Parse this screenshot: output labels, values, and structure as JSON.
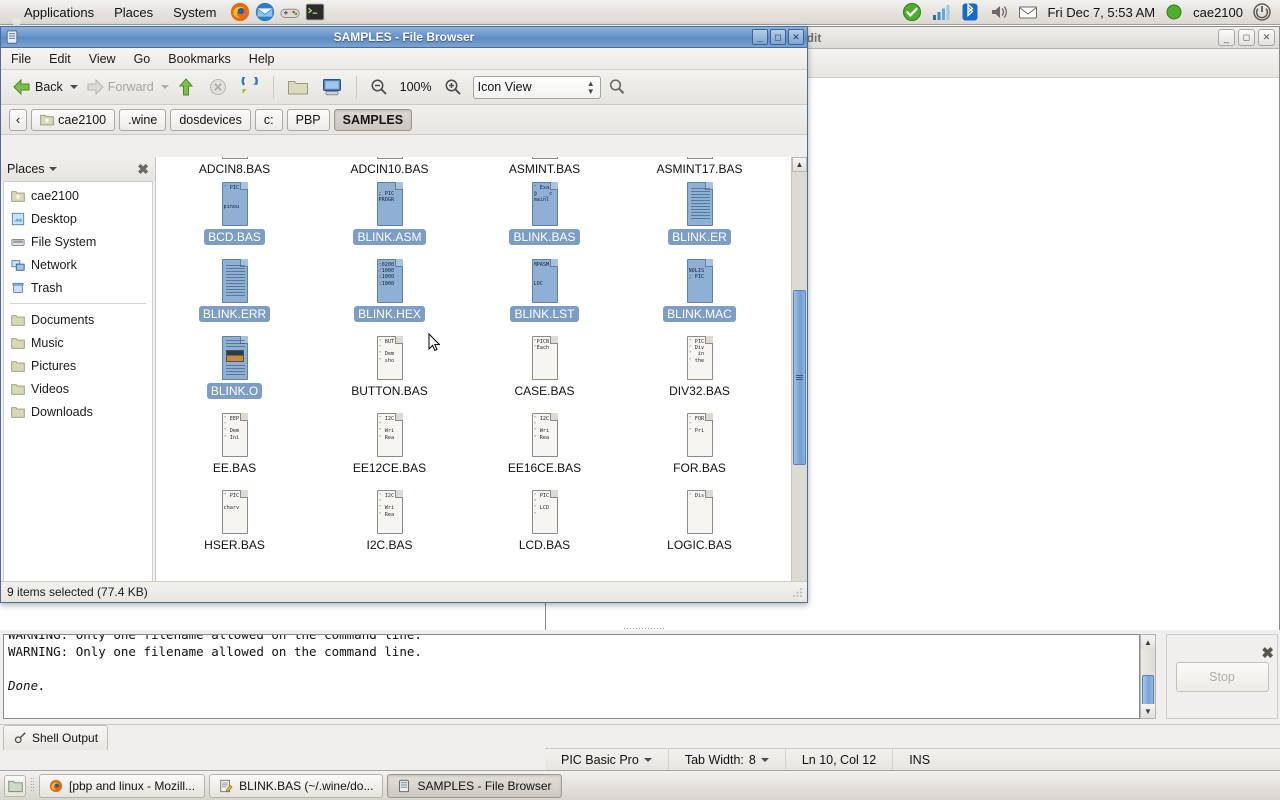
{
  "top_panel": {
    "menus": [
      "Applications",
      "Places",
      "System"
    ],
    "launchers": [
      "firefox-icon",
      "thunderbird-icon",
      "gamepad-icon",
      "terminal-icon"
    ],
    "tray": [
      "update-manager-icon",
      "network-signal-icon",
      "bluetooth-icon",
      "volume-icon",
      "mail-icon"
    ],
    "clock": "Fri Dec  7,  5:53 AM",
    "user": "cae2100",
    "power": "power-icon"
  },
  "gedit_window": {
    "title": "edit",
    "buttons": [
      "minimize",
      "maximize",
      "close"
    ]
  },
  "file_browser": {
    "title": "SAMPLES - File Browser",
    "window_buttons": [
      "minimize",
      "maximize",
      "close"
    ],
    "menus": [
      "File",
      "Edit",
      "View",
      "Go",
      "Bookmarks",
      "Help"
    ],
    "toolbar": {
      "back": "Back",
      "forward": "Forward",
      "up": "up-icon",
      "stop": "stop-icon",
      "reload": "reload-icon",
      "home": "home-icon",
      "computer": "computer-icon",
      "zoom_out": "zoom-out-icon",
      "zoom_level": "100%",
      "zoom_in": "zoom-in-icon",
      "view_mode": "Icon View",
      "search": "search-icon"
    },
    "pathbar": {
      "prev": "‹",
      "crumbs": [
        {
          "label": "cae2100",
          "icon": "home-folder-icon",
          "active": false
        },
        {
          "label": ".wine",
          "active": false
        },
        {
          "label": "dosdevices",
          "active": false
        },
        {
          "label": "c:",
          "active": false
        },
        {
          "label": "PBP",
          "active": false
        },
        {
          "label": "SAMPLES",
          "active": true
        }
      ]
    },
    "sidebar": {
      "header": "Places",
      "close": "close-icon",
      "group1": [
        {
          "label": "cae2100",
          "icon": "home-folder-icon"
        },
        {
          "label": "Desktop",
          "icon": "desktop-icon"
        },
        {
          "label": "File System",
          "icon": "drive-icon"
        },
        {
          "label": "Network",
          "icon": "network-icon"
        },
        {
          "label": "Trash",
          "icon": "trash-icon"
        }
      ],
      "group2": [
        {
          "label": "Documents",
          "icon": "folder-icon"
        },
        {
          "label": "Music",
          "icon": "folder-icon"
        },
        {
          "label": "Pictures",
          "icon": "folder-icon"
        },
        {
          "label": "Videos",
          "icon": "folder-icon"
        },
        {
          "label": "Downloads",
          "icon": "folder-icon"
        }
      ]
    },
    "files": {
      "row_clipped": [
        {
          "name": "ADCIN8.BAS",
          "selected": false
        },
        {
          "name": "ADCIN10.BAS",
          "selected": false
        },
        {
          "name": "ASMINT.BAS",
          "selected": false
        },
        {
          "name": "ASMINT17.BAS",
          "selected": false
        }
      ],
      "rows": [
        [
          {
            "name": "BCD.BAS",
            "selected": true,
            "kind": "text",
            "preview": "' PIC\n\n\npinou"
          },
          {
            "name": "BLINK.ASM",
            "selected": true,
            "kind": "text",
            "preview": "\n; PIC\nPROGR"
          },
          {
            "name": "BLINK.BAS",
            "selected": true,
            "kind": "text",
            "preview": "' Exa\n@  __c\nmainl"
          },
          {
            "name": "BLINK.ER",
            "selected": true,
            "kind": "lines",
            "preview": ""
          }
        ],
        [
          {
            "name": "BLINK.ERR",
            "selected": true,
            "kind": "lines",
            "preview": ""
          },
          {
            "name": "BLINK.HEX",
            "selected": true,
            "kind": "text",
            "preview": ":0200\n:1000\n:1000\n:1000"
          },
          {
            "name": "BLINK.LST",
            "selected": true,
            "kind": "text",
            "preview": "MPASM\n\n\nLOC"
          },
          {
            "name": "BLINK.MAC",
            "selected": true,
            "kind": "text",
            "preview": "\nNOLIS\n; PIC"
          }
        ],
        [
          {
            "name": "BLINK.O",
            "selected": true,
            "kind": "image",
            "preview": ""
          },
          {
            "name": "BUTTON.BAS",
            "selected": false,
            "kind": "text",
            "preview": "' BUT\n'\n' Dem\n' sho"
          },
          {
            "name": "CASE.BAS",
            "selected": false,
            "kind": "text",
            "preview": "'PICB\n'Each"
          },
          {
            "name": "DIV32.BAS",
            "selected": false,
            "kind": "text",
            "preview": "' PIC\n' Div\n'  in\n' the"
          }
        ],
        [
          {
            "name": "EE.BAS",
            "selected": false,
            "kind": "text",
            "preview": "' EEP\n'\n' Dem\n' Ini"
          },
          {
            "name": "EE12CE.BAS",
            "selected": false,
            "kind": "text",
            "preview": "' I2C\n'\n' Wri\n' Rea"
          },
          {
            "name": "EE16CE.BAS",
            "selected": false,
            "kind": "text",
            "preview": "' I2C\n'\n' Wri\n' Rea"
          },
          {
            "name": "FOR.BAS",
            "selected": false,
            "kind": "text",
            "preview": "' FOR\n'\n' Pri"
          }
        ],
        [
          {
            "name": "HSER.BAS",
            "selected": false,
            "kind": "text",
            "preview": "' PIC\n\ncharv"
          },
          {
            "name": "I2C.BAS",
            "selected": false,
            "kind": "text",
            "preview": "' I2C\n'\n' Wri\n' Rea"
          },
          {
            "name": "LCD.BAS",
            "selected": false,
            "kind": "text",
            "preview": "' PIC\n'\n' LCD\n'"
          },
          {
            "name": "LOGIC.BAS",
            "selected": false,
            "kind": "text",
            "preview": "' Dis"
          }
        ]
      ]
    },
    "status": "9 items selected (77.4 KB)"
  },
  "shell_output": {
    "lines": [
      "WARNING: Only one filename allowed on the command line.",
      "WARNING: Only one filename allowed on the command line.",
      "",
      "Done."
    ],
    "stop_button": "Stop",
    "close": "close-icon",
    "tab": "Shell Output",
    "tab_icon": "shell-icon"
  },
  "editor_status": {
    "language": "PIC Basic Pro",
    "tab_width_label": "Tab Width:",
    "tab_width_value": "8",
    "position": "Ln 10, Col 12",
    "insert_mode": "INS"
  },
  "taskbar": {
    "show_desktop": "show-desktop-icon",
    "tasks": [
      {
        "label": "[pbp and linux - Mozill...",
        "icon": "firefox-icon",
        "active": false
      },
      {
        "label": "BLINK.BAS (~/.wine/do...",
        "icon": "gedit-icon",
        "active": false
      },
      {
        "label": "SAMPLES - File Browser",
        "icon": "nautilus-icon",
        "active": true
      }
    ]
  },
  "colors": {
    "selection_blue": "#7c9dc4",
    "titlebar_blue": "#6a95ca",
    "panel_grey": "#e6e3de"
  }
}
